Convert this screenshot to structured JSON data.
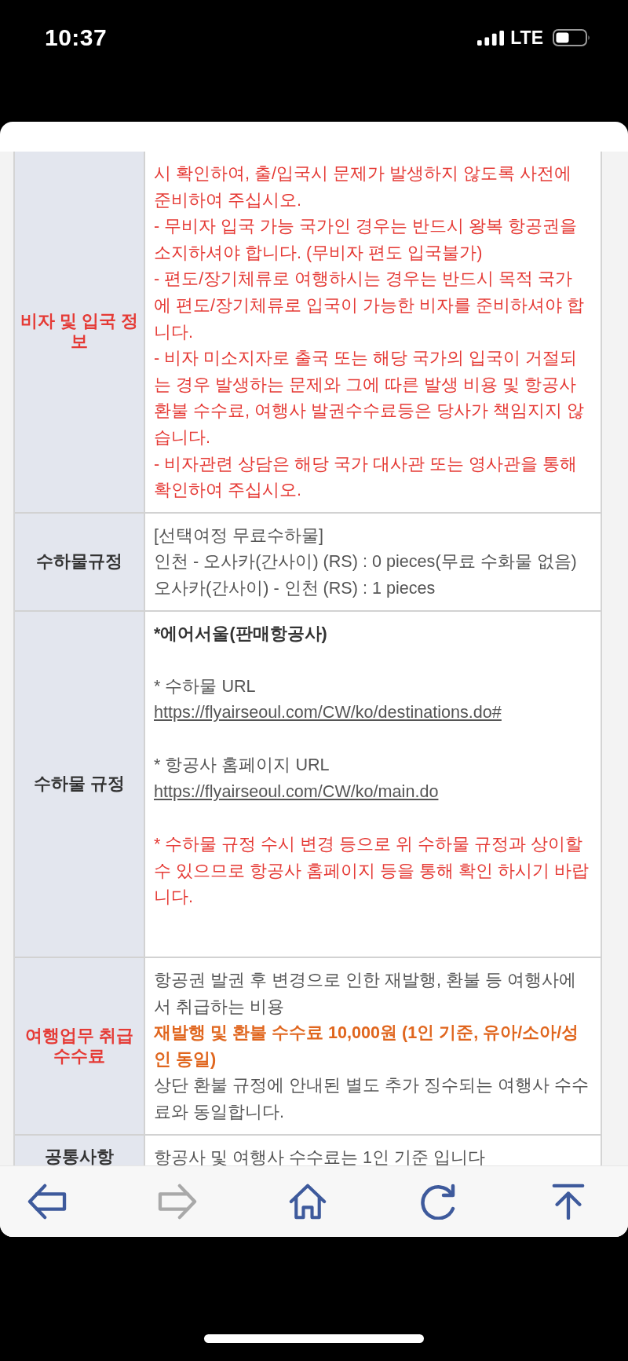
{
  "status_bar": {
    "time": "10:37",
    "network": "LTE"
  },
  "table": {
    "rows": [
      {
        "label": "비자 및 입국 정보",
        "highlight": true,
        "sections": [
          [
            {
              "kind": "warning",
              "text": "시 확인하여, 출/입국시 문제가 발생하지 않도록 사전에 준비하여 주십시오."
            },
            {
              "kind": "warning",
              "text": "- 무비자 입국 가능 국가인 경우는 반드시 왕복 항공권을 소지하셔야 합니다. (무비자 편도 입국불가)"
            },
            {
              "kind": "warning",
              "text": "- 편도/장기체류로 여행하시는 경우는 반드시 목적 국가에 편도/장기체류로 입국이 가능한 비자를 준비하셔야 합니다."
            },
            {
              "kind": "warning",
              "text": "- 비자 미소지자로 출국 또는 해당 국가의 입국이 거절되는 경우 발생하는 문제와 그에 따른 발생 비용 및 항공사 환불 수수료, 여행사 발권수수료등은 당사가 책임지지 않습니다."
            },
            {
              "kind": "warning",
              "text": "- 비자관련 상담은 해당 국가 대사관 또는 영사관을 통해 확인하여 주십시오."
            }
          ]
        ]
      },
      {
        "label": "수하물규정",
        "highlight": false,
        "sections": [
          [
            {
              "kind": "text",
              "text": "[선택여정 무료수하물]"
            },
            {
              "kind": "text",
              "text": "인천 - 오사카(간사이) (RS) : 0 pieces(무료 수화물 없음)"
            },
            {
              "kind": "text",
              "text": "오사카(간사이) - 인천 (RS) : 1 pieces"
            }
          ]
        ]
      },
      {
        "label": "수하물 규정",
        "highlight": false,
        "sections": [
          [
            {
              "kind": "heading",
              "text": "*에어서울(판매항공사)"
            }
          ],
          [
            {
              "kind": "text",
              "text": "* 수하물 URL"
            },
            {
              "kind": "link",
              "text": "https://flyairseoul.com/CW/ko/destinations.do#"
            }
          ],
          [
            {
              "kind": "text",
              "text": "* 항공사 홈페이지 URL"
            },
            {
              "kind": "link",
              "text": "https://flyairseoul.com/CW/ko/main.do"
            }
          ],
          [
            {
              "kind": "warning",
              "text": "* 수하물 규정 수시 변경 등으로 위 수하물 규정과 상이할 수 있으므로 항공사 홈페이지 등을 통해 확인 하시기 바랍니다."
            }
          ]
        ]
      },
      {
        "label": "여행업무 취급 수수료",
        "highlight": true,
        "sections": [
          [
            {
              "kind": "text",
              "text": "항공권 발권 후 변경으로 인한 재발행, 환불 등 여행사에서 취급하는 비용"
            },
            {
              "kind": "accent",
              "text": "재발행 및 환불 수수료 10,000원 (1인 기준, 유아/소아/성인 동일)"
            },
            {
              "kind": "text",
              "text": "상단 환불 규정에 안내된 별도 추가 징수되는 여행사 수수료와 동일합니다."
            }
          ]
        ]
      },
      {
        "label": "공통사항",
        "highlight": false,
        "sections": [
          [
            {
              "kind": "text",
              "text": "항공사 및 여행사 수수료는 1인 기준 입니다"
            }
          ]
        ]
      }
    ]
  },
  "toolbar": {
    "buttons": [
      {
        "kind": "back",
        "disabled": false
      },
      {
        "kind": "forward",
        "disabled": true
      },
      {
        "kind": "home",
        "disabled": false
      },
      {
        "kind": "reload",
        "disabled": false
      },
      {
        "kind": "top",
        "disabled": false
      }
    ]
  }
}
